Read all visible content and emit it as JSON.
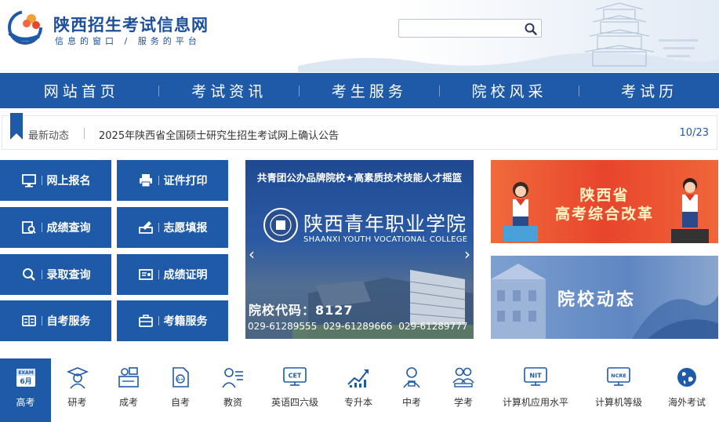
{
  "header": {
    "site_title": "陕西招生考试信息网",
    "slogan": "信息的窗口 / 服务的平台",
    "search": {
      "value": "",
      "placeholder": ""
    }
  },
  "nav": {
    "items": [
      "网站首页",
      "考试资讯",
      "考生服务",
      "院校风采",
      "考试历"
    ]
  },
  "ticker": {
    "label": "最新动态",
    "headline": "2025年陕西省全国硕士研究生招生考试网上确认公告",
    "date": "10/23"
  },
  "quick_buttons": [
    {
      "label": "网上报名",
      "icon": "monitor-icon"
    },
    {
      "label": "证件打印",
      "icon": "printer-icon"
    },
    {
      "label": "成绩查询",
      "icon": "score-search-icon"
    },
    {
      "label": "志愿填报",
      "icon": "pen-form-icon"
    },
    {
      "label": "录取查询",
      "icon": "magnifier-icon"
    },
    {
      "label": "成绩证明",
      "icon": "certificate-icon"
    },
    {
      "label": "自考服务",
      "icon": "id-card-icon"
    },
    {
      "label": "考籍服务",
      "icon": "briefcase-icon"
    }
  ],
  "banner": {
    "top_line": "共青团公办品牌院校★高素质技术技能人才摇篮",
    "school_name": "陕西青年职业学院",
    "school_en": "SHAANXI YOUTH VOCATIONAL COLLEGE",
    "code": "院校代码：8127",
    "phones": "029-61289555  029-61289666  029-61289777"
  },
  "promos": {
    "reform_line1": "陕西省",
    "reform_line2": "高考综合改革",
    "college_news": "院校动态"
  },
  "categories": [
    {
      "label": "高考",
      "icon": "exam-calendar-icon",
      "badge_top": "EXAM",
      "badge_bottom": "6月",
      "active": true
    },
    {
      "label": "研考",
      "icon": "graduate-icon"
    },
    {
      "label": "成考",
      "icon": "adult-exam-icon"
    },
    {
      "label": "自考",
      "icon": "self-exam-doc-icon"
    },
    {
      "label": "教资",
      "icon": "teacher-icon"
    },
    {
      "label": "英语四六级",
      "icon": "cet-icon",
      "badge": "CET"
    },
    {
      "label": "专升本",
      "icon": "rising-chart-icon"
    },
    {
      "label": "中考",
      "icon": "student-icon"
    },
    {
      "label": "学考",
      "icon": "group-study-icon"
    },
    {
      "label": "计算机应用水平",
      "icon": "nit-icon",
      "badge": "NIT"
    },
    {
      "label": "计算机等级",
      "icon": "ncre-icon",
      "badge": "NCRE"
    },
    {
      "label": "海外考试",
      "icon": "globe-icon"
    }
  ],
  "colors": {
    "primary_blue": "#1e5aa8",
    "reform_red": "#e8452c",
    "news_blue": "#6a8fc6"
  }
}
